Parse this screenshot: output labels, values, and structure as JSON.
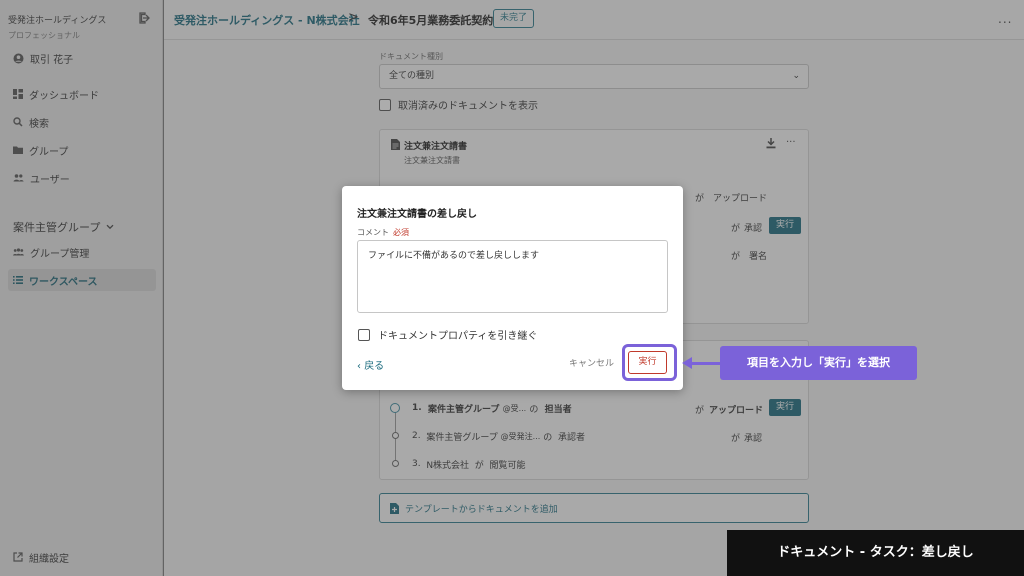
{
  "sidebar": {
    "org_name": "受発注ホールディングス",
    "org_plan": "プロフェッショナル",
    "user_name": "取引 花子",
    "nav": [
      {
        "label": "ダッシュボード",
        "icon": "dashboard-icon"
      },
      {
        "label": "検索",
        "icon": "search-icon"
      },
      {
        "label": "グループ",
        "icon": "folder-icon"
      },
      {
        "label": "ユーザー",
        "icon": "users-icon"
      }
    ],
    "group_header": "案件主管グループ",
    "group_items": [
      {
        "label": "グループ管理",
        "icon": "group-icon"
      },
      {
        "label": "ワークスペース",
        "icon": "list-icon"
      }
    ],
    "settings_label": "組織設定"
  },
  "topbar": {
    "breadcrumb_parent": "受発注ホールディングス - N株式会社",
    "breadcrumb_separator": ">",
    "breadcrumb_current": "令和6年5月業務委託契約",
    "status_badge": "未完了",
    "more": "..."
  },
  "filters": {
    "doc_type_label": "ドキュメント種別",
    "doc_type_value": "全ての種別",
    "show_cancelled_label": "取消済みのドキュメントを表示"
  },
  "document_card": {
    "title": "注文兼注文請書",
    "subtitle": "注文兼注文請書",
    "bg_upload": "が　アップロード",
    "bg_approve_ga": "が",
    "bg_approve": "承認",
    "bg_exec": "実行",
    "bg_sign": "が　署名"
  },
  "workflow": {
    "steps": [
      {
        "num": "1.",
        "group": "案件主管グループ",
        "who": "@受...",
        "no": "の",
        "role": "担当者",
        "ga": "が",
        "action": "アップロード",
        "button": "実行"
      },
      {
        "num": "2.",
        "group": "案件主管グループ",
        "who": "@受発注...",
        "no": "の",
        "role": "承認者",
        "ga": "が",
        "action": "承認"
      },
      {
        "num": "3.",
        "group": "N株式会社",
        "ga": "が",
        "action": "閲覧可能"
      }
    ],
    "add_template_label": "テンプレートからドキュメントを追加"
  },
  "modal": {
    "title": "注文兼注文請書の差し戻し",
    "comment_label": "コメント",
    "required_label": "必須",
    "comment_value": "ファイルに不備があるので差し戻しします",
    "inherit_label": "ドキュメントプロパティを引き継ぐ",
    "back_label": "戻る",
    "cancel_label": "キャンセル",
    "execute_label": "実行"
  },
  "annotation": {
    "text": "項目を入力し「実行」を選択",
    "color": "#7b62d9"
  },
  "footer_caption": "ドキュメント - タスク：差し戻し"
}
